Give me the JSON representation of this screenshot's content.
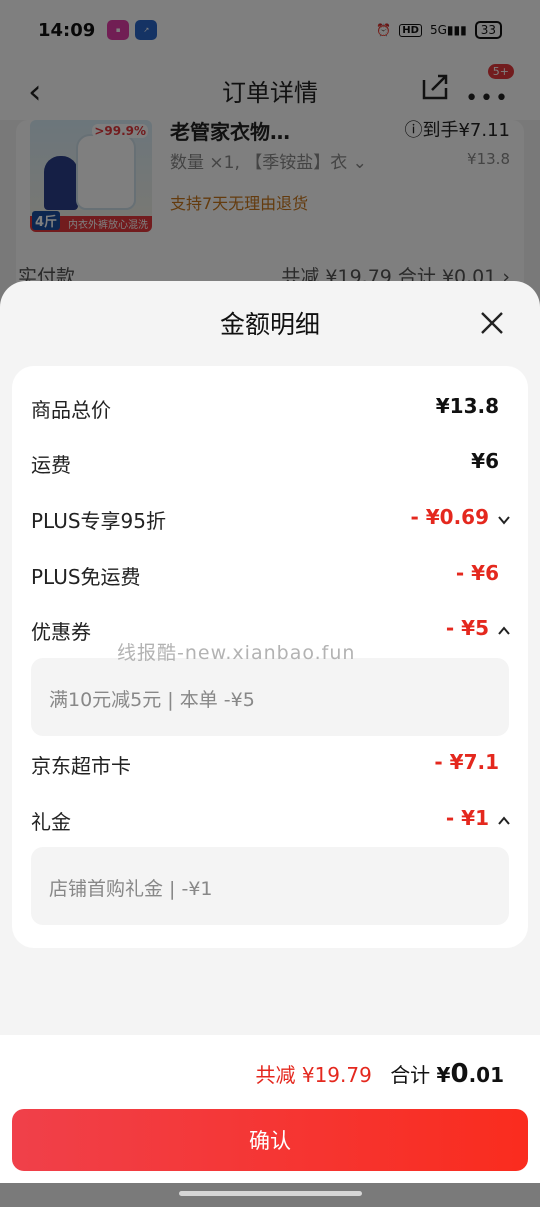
{
  "status_bar": {
    "time": "14:09",
    "network": "5G",
    "hd": "HD",
    "battery": "33"
  },
  "nav": {
    "title": "订单详情",
    "badge": "5+"
  },
  "product": {
    "title": "老管家衣物…",
    "arrival": "ⓘ到手¥7.11",
    "spec": "数量 ×1, 【季铵盐】衣 ⌄",
    "price": "¥13.8",
    "return_policy": "支持7天无理由退货",
    "img_tag_pct": ">99.9%",
    "img_tag_weight": "4斤",
    "img_banner": "内衣外裤放心混洗"
  },
  "background_summary": {
    "label": "实付款",
    "total": "共减 ¥19.79  合计 ¥0.01 ›"
  },
  "sheet": {
    "title": "金额明细",
    "rows": [
      {
        "label": "商品总价",
        "value": "¥13.8"
      },
      {
        "label": "运费",
        "value": "¥6"
      },
      {
        "label": "PLUS专享95折",
        "value": "- ¥0.69"
      },
      {
        "label": "PLUS免运费",
        "value": "- ¥6"
      },
      {
        "label": "优惠券",
        "value": "- ¥5"
      },
      {
        "label": "京东超市卡",
        "value": "- ¥7.1"
      },
      {
        "label": "礼金",
        "value": "- ¥1"
      }
    ],
    "coupon_detail": "满10元减5元 | 本单 -¥5",
    "gift_detail": "店铺首购礼金 | -¥1",
    "watermark": "线报酷-new.xianbao.fun"
  },
  "footer": {
    "reduced": "共减 ¥19.79",
    "total_label": "合计",
    "currency": "¥",
    "total_int": "0",
    "total_dec": ".01",
    "confirm": "确认"
  },
  "colors": {
    "accent_red": "#e4281e",
    "button_gradient_start": "#f0404a",
    "button_gradient_end": "#fa2c1e"
  }
}
